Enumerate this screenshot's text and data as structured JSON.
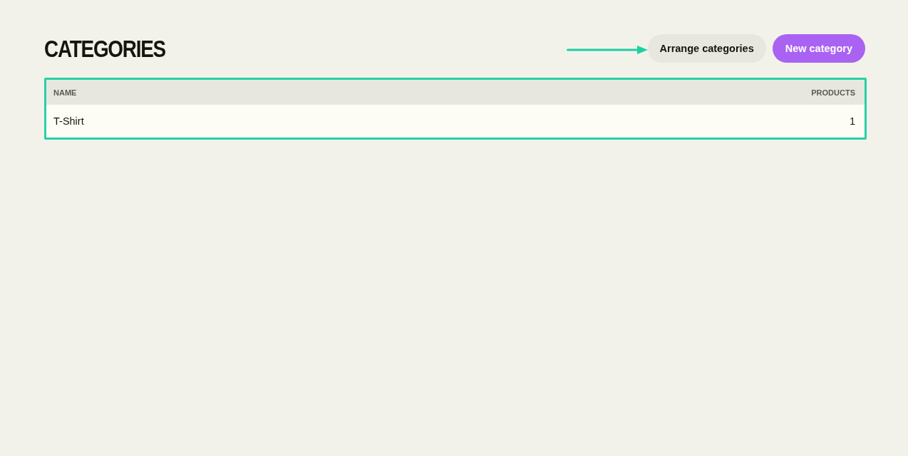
{
  "page": {
    "title": "CATEGORIES"
  },
  "buttons": [
    {
      "label": "Arrange categories",
      "kind": "secondary",
      "highlighted": true
    },
    {
      "label": "New category",
      "kind": "primary",
      "highlighted": false
    }
  ],
  "table": {
    "highlighted": true,
    "columns": [
      {
        "label": "NAME",
        "kind": "text"
      },
      {
        "label": "PRODUCTS",
        "kind": "count"
      }
    ],
    "rows": [
      {
        "cells": [
          "T-Shirt",
          "1"
        ]
      }
    ]
  }
}
